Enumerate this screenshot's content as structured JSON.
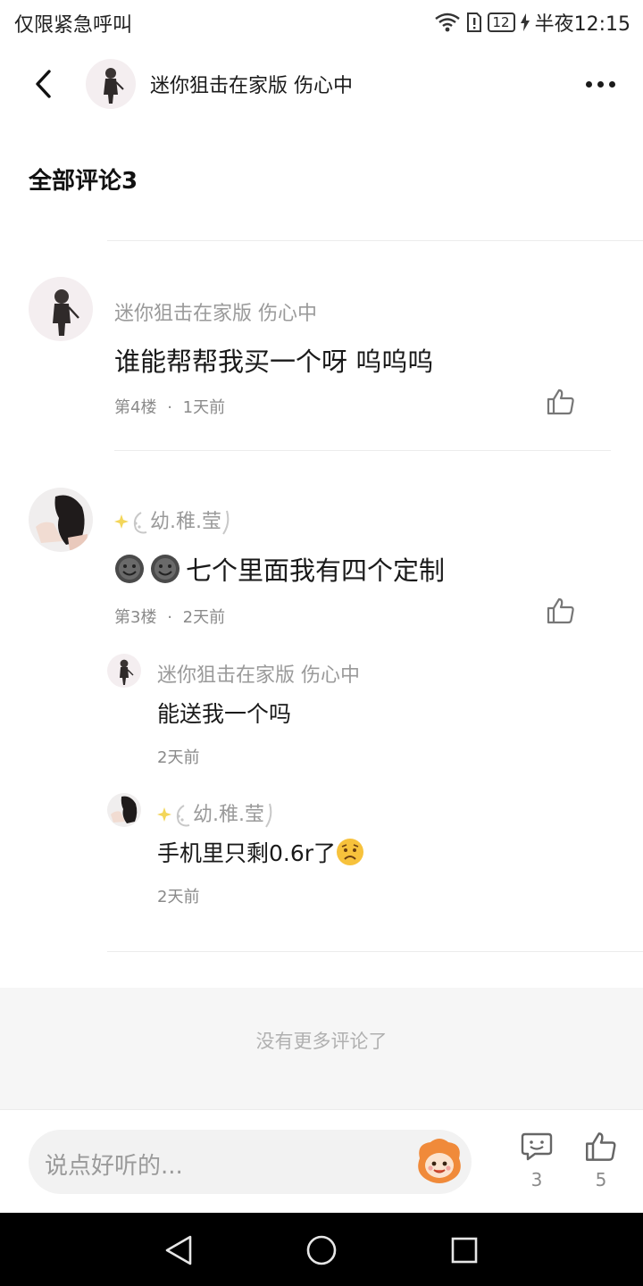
{
  "status_bar": {
    "left_text": "仅限紧急呼叫",
    "battery": "12",
    "time": "半夜12:15"
  },
  "header": {
    "title": "迷你狙击在家版 伤心中"
  },
  "section": {
    "title": "全部评论3"
  },
  "comments": [
    {
      "username": "迷你狙击在家版 伤心中",
      "content": "谁能帮帮我买一个呀 呜呜呜",
      "floor": "第4楼",
      "time": "1天前"
    },
    {
      "username": "幼.稚.莹",
      "content": "七个里面我有四个定制",
      "floor": "第3楼",
      "time": "2天前",
      "replies": [
        {
          "username": "迷你狙击在家版 伤心中",
          "content": "能送我一个吗",
          "time": "2天前"
        },
        {
          "username": "幼.稚.莹",
          "content": "手机里只剩0.6r了",
          "time": "2天前"
        }
      ]
    }
  ],
  "footer": {
    "no_more": "没有更多评论了"
  },
  "bottom_bar": {
    "placeholder": "说点好听的...",
    "comment_count": "3",
    "like_count": "5"
  },
  "meta_separator": "·"
}
